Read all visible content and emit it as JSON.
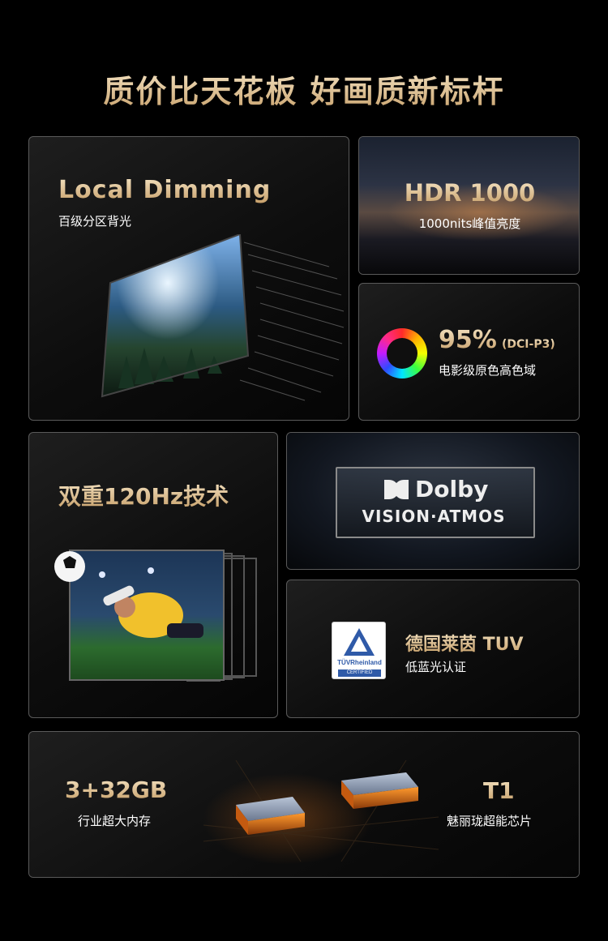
{
  "headline": "质价比天花板  好画质新标杆",
  "cards": {
    "local_dimming": {
      "title": "Local Dimming",
      "subtitle": "百级分区背光"
    },
    "hdr": {
      "title": "HDR 1000",
      "subtitle": "1000nits峰值亮度"
    },
    "color_gamut": {
      "percent": "95%",
      "standard": "(DCI-P3)",
      "subtitle": "电影级原色高色域"
    },
    "refresh": {
      "title": "双重120Hz技术"
    },
    "dolby": {
      "brand": "Dolby",
      "line2": "VISION·ATMOS"
    },
    "tuv": {
      "title": "德国莱茵 TUV",
      "subtitle": "低蓝光认证",
      "badge_brand": "TÜVRheinland",
      "badge_cert": "CERTIFIED"
    },
    "chip": {
      "memory_title": "3+32GB",
      "memory_subtitle": "行业超大内存",
      "chip_title": "T1",
      "chip_subtitle": "魅丽珑超能芯片"
    }
  },
  "colors": {
    "gold_light": "#f5e4c4",
    "gold_dark": "#c59d66",
    "background": "#000000",
    "card_border": "#5a5a5a",
    "tuv_blue": "#2f5aa8"
  }
}
